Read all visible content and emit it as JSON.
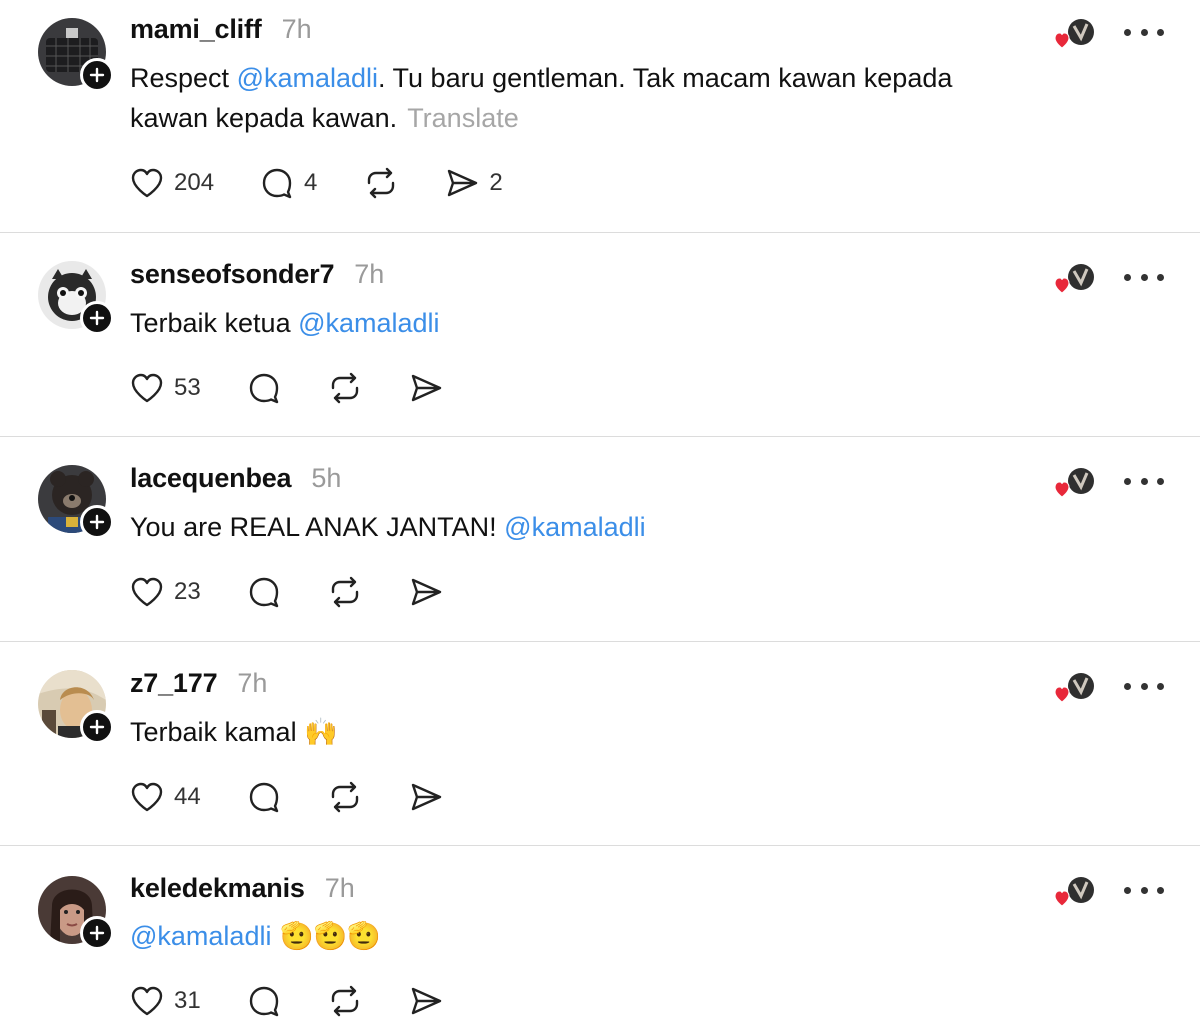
{
  "posts": [
    {
      "username": "mami_cliff",
      "time": "7h",
      "text_before": "Respect ",
      "mention": "@kamaladli",
      "text_after": ". Tu baru gentleman. Tak macam kawan kepada kawan kepada kawan.",
      "translate": "Translate",
      "likes": "204",
      "replies": "4",
      "reposts": "",
      "shares": "2"
    },
    {
      "username": "senseofsonder7",
      "time": "7h",
      "text_before": "Terbaik ketua ",
      "mention": "@kamaladli",
      "text_after": "",
      "translate": "",
      "likes": "53",
      "replies": "",
      "reposts": "",
      "shares": ""
    },
    {
      "username": "lacequenbea",
      "time": "5h",
      "text_before": "You are REAL ANAK JANTAN! ",
      "mention": "@kamaladli",
      "text_after": "",
      "translate": "",
      "likes": "23",
      "replies": "",
      "reposts": "",
      "shares": ""
    },
    {
      "username": "z7_177",
      "time": "7h",
      "text_before": "Terbaik kamal ",
      "mention": "",
      "text_after": "🙌",
      "translate": "",
      "likes": "44",
      "replies": "",
      "reposts": "",
      "shares": ""
    },
    {
      "username": "keledekmanis",
      "time": "7h",
      "text_before": "",
      "mention": "@kamaladli",
      "text_after": " 🫡🫡🫡",
      "translate": "",
      "likes": "31",
      "replies": "",
      "reposts": "",
      "shares": ""
    }
  ],
  "icons": {
    "like": "heart-icon",
    "reply": "comment-icon",
    "repost": "repost-icon",
    "share": "send-icon",
    "more": "more-icon",
    "follow": "plus-icon",
    "liked_by_author": "liked-by-author-icon"
  },
  "colors": {
    "mention": "#3b8ee8",
    "muted": "#9a9a9a",
    "heart_red": "#e8283a",
    "divider": "#dcdcdc"
  }
}
